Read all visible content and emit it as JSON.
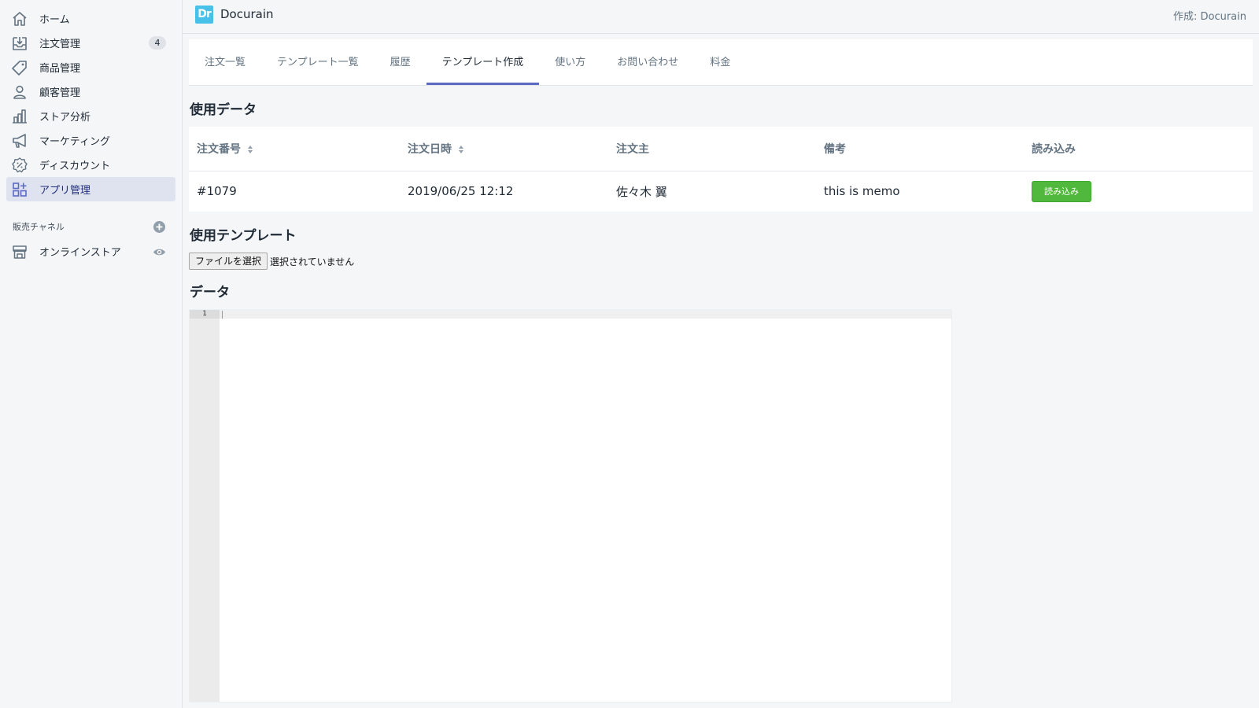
{
  "sidebar": {
    "items": [
      {
        "label": "ホーム",
        "icon": "home-icon"
      },
      {
        "label": "注文管理",
        "icon": "inbox-download-icon",
        "badge": "4"
      },
      {
        "label": "商品管理",
        "icon": "tag-icon"
      },
      {
        "label": "顧客管理",
        "icon": "person-icon"
      },
      {
        "label": "ストア分析",
        "icon": "bar-chart-icon"
      },
      {
        "label": "マーケティング",
        "icon": "megaphone-icon"
      },
      {
        "label": "ディスカウント",
        "icon": "discount-badge-icon"
      },
      {
        "label": "アプリ管理",
        "icon": "apps-grid-icon",
        "active": true
      }
    ],
    "channels_header": "販売チャネル",
    "channels": [
      {
        "label": "オンラインストア",
        "icon": "store-icon"
      }
    ]
  },
  "topbar": {
    "app_title": "Docurain",
    "logo_text": "Dr",
    "byline": "作成: Docurain"
  },
  "tabs": [
    {
      "label": "注文一覧"
    },
    {
      "label": "テンプレート一覧"
    },
    {
      "label": "履歴"
    },
    {
      "label": "テンプレート作成",
      "active": true
    },
    {
      "label": "使い方"
    },
    {
      "label": "お問い合わせ"
    },
    {
      "label": "料金"
    }
  ],
  "data_section": {
    "title": "使用データ",
    "columns": [
      "注文番号",
      "注文日時",
      "注文主",
      "備考",
      "読み込み"
    ],
    "rows": [
      {
        "order_no": "#1079",
        "datetime": "2019/06/25 12:12",
        "customer": "佐々木 翼",
        "memo": "this is memo",
        "button_label": "読み込み"
      }
    ]
  },
  "template_section": {
    "title": "使用テンプレート",
    "file_button": "ファイルを選択",
    "file_status": "選択されていません"
  },
  "editor_section": {
    "title": "データ",
    "line_number": "1"
  },
  "colors": {
    "accent": "#5c6ac4",
    "button_green": "#50b83c",
    "logo_blue": "#47c1e8"
  }
}
